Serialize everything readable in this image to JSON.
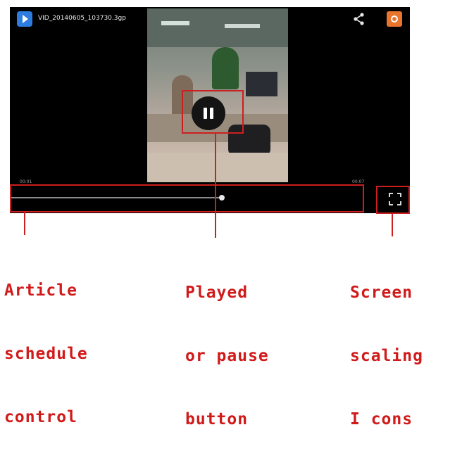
{
  "player": {
    "title": "VID_20140605_103730.3gp",
    "time_current": "00:01",
    "time_total": "00:07",
    "progress": 0.6,
    "icons": {
      "app_logo": "play-logo-icon",
      "share": "share-icon",
      "settings": "settings-icon",
      "pause": "pause-icon",
      "fullscreen": "fullscreen-icon"
    }
  },
  "annotations": {
    "color": "#cc1f1f",
    "progress_label": [
      "Article",
      "schedule",
      "control"
    ],
    "pause_label": [
      "Played",
      "or pause",
      "button"
    ],
    "screen_label": [
      "Screen",
      "scaling",
      "I cons"
    ]
  }
}
